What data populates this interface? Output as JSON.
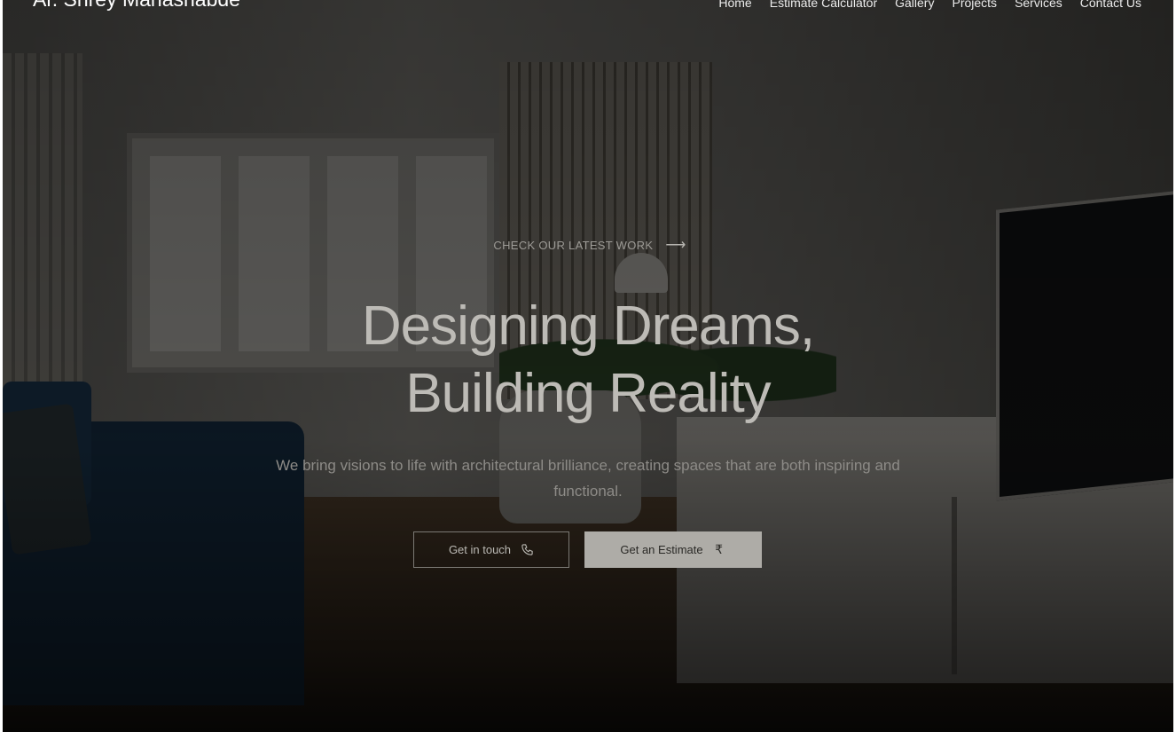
{
  "header": {
    "brand": "Ar. Shrey Mahashabde",
    "nav": [
      {
        "label": "Home"
      },
      {
        "label": "Estimate Calculator"
      },
      {
        "label": "Gallery"
      },
      {
        "label": "Projects"
      },
      {
        "label": "Services"
      },
      {
        "label": "Contact Us"
      }
    ]
  },
  "hero": {
    "kicker": "CHECK OUR LATEST WORK",
    "kicker_icon": "arrow-right-icon",
    "headline_line1": "Designing Dreams,",
    "headline_line2": "Building Reality",
    "subtext": "We bring visions to life with architectural brilliance, creating spaces that are both inspiring and functional.",
    "buttons": {
      "contact": {
        "label": "Get in touch",
        "icon": "phone-icon"
      },
      "estimate": {
        "label": "Get an Estimate",
        "icon": "rupee-icon"
      }
    }
  },
  "colors": {
    "overlay": "#000000",
    "headline": "#bdbbb6",
    "button_solid": "#aeaca7"
  }
}
